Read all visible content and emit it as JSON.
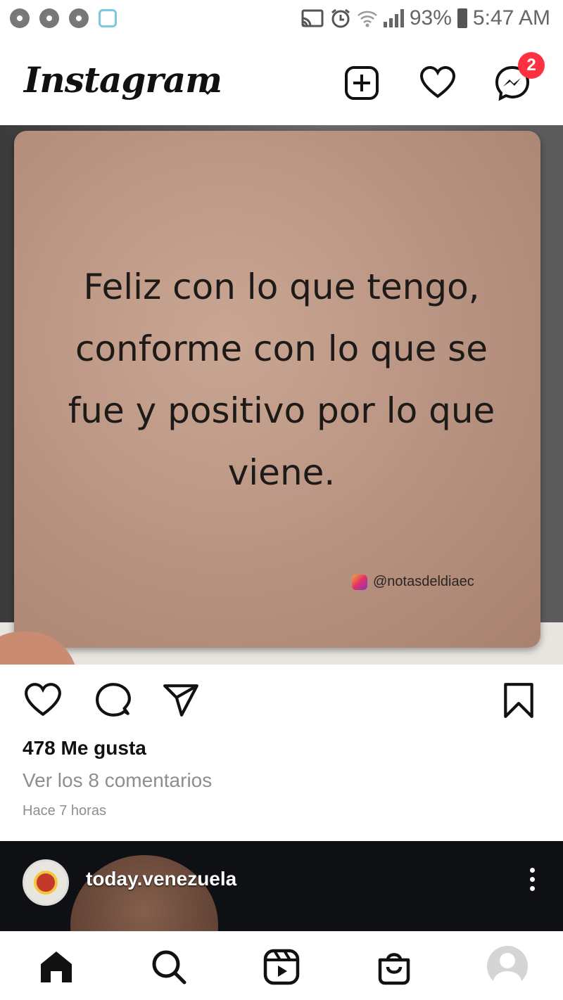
{
  "status_bar": {
    "battery": "93%",
    "time": "5:47 AM",
    "icons": [
      "chrome-icon",
      "chrome-icon",
      "chrome-icon",
      "app-icon",
      "cast-icon",
      "alarm-icon",
      "wifi-icon",
      "signal-icon",
      "battery-icon"
    ]
  },
  "header": {
    "logo": "Instagram",
    "new_post_icon": "plus-square-icon",
    "activity_icon": "heart-icon",
    "messenger_icon": "messenger-icon",
    "messenger_badge": "2",
    "badge_color": "#ff3040"
  },
  "post": {
    "image_text": "Feliz con lo que tengo, conforme con lo que se fue y positivo por lo que viene.",
    "image_handle": "@notasdeldiaec",
    "likes": "478 Me gusta",
    "comments_link": "Ver los 8 comentarios",
    "timestamp": "Hace 7 horas",
    "actions": [
      "like-icon",
      "comment-icon",
      "share-icon",
      "bookmark-icon"
    ]
  },
  "next_post": {
    "username": "today.venezuela",
    "more_icon": "more-vertical-icon"
  },
  "bottom_nav": {
    "items": [
      "home-icon",
      "search-icon",
      "reels-icon",
      "shop-icon",
      "profile-avatar"
    ]
  }
}
